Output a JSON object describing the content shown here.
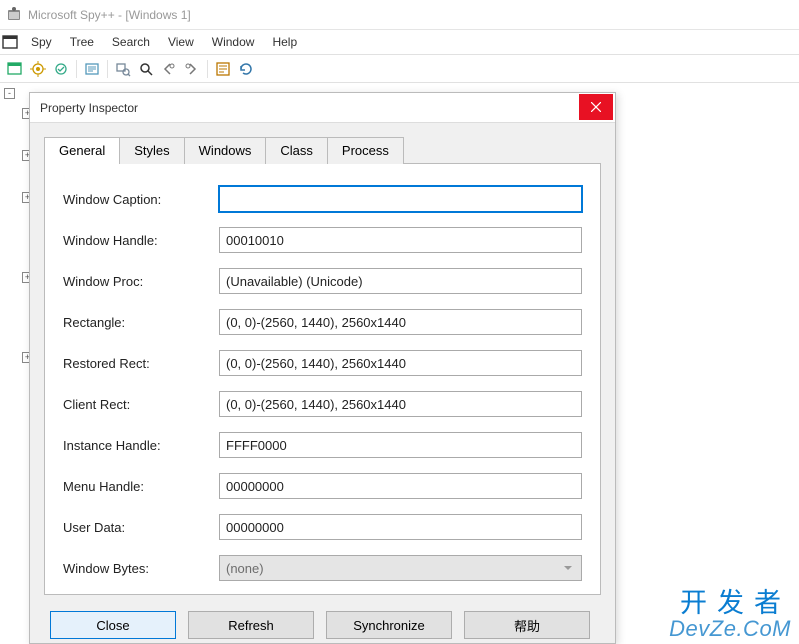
{
  "titlebar": {
    "text": "Microsoft Spy++ - [Windows 1]"
  },
  "menubar": {
    "items": [
      "Spy",
      "Tree",
      "Search",
      "View",
      "Window",
      "Help"
    ]
  },
  "tree": {
    "root_toggle": "-",
    "child_toggle": "+"
  },
  "dialog": {
    "title": "Property Inspector",
    "tabs": [
      "General",
      "Styles",
      "Windows",
      "Class",
      "Process"
    ],
    "active_tab": 0,
    "fields": {
      "window_caption": {
        "label": "Window Caption:",
        "value": ""
      },
      "window_handle": {
        "label": "Window Handle:",
        "value": "00010010"
      },
      "window_proc": {
        "label": "Window Proc:",
        "value": "(Unavailable) (Unicode)"
      },
      "rectangle": {
        "label": "Rectangle:",
        "value": "(0, 0)-(2560, 1440), 2560x1440"
      },
      "restored_rect": {
        "label": "Restored Rect:",
        "value": "(0, 0)-(2560, 1440), 2560x1440"
      },
      "client_rect": {
        "label": "Client Rect:",
        "value": "(0, 0)-(2560, 1440), 2560x1440"
      },
      "instance_handle": {
        "label": "Instance Handle:",
        "value": "FFFF0000"
      },
      "menu_handle": {
        "label": "Menu Handle:",
        "value": "00000000"
      },
      "user_data": {
        "label": "User Data:",
        "value": "00000000"
      },
      "window_bytes": {
        "label": "Window Bytes:",
        "value": "(none)"
      }
    },
    "buttons": {
      "close": "Close",
      "refresh": "Refresh",
      "synchronize": "Synchronize",
      "help": "帮助"
    }
  },
  "watermark": {
    "cn": "开发者",
    "en": "DevZe.CoM"
  }
}
